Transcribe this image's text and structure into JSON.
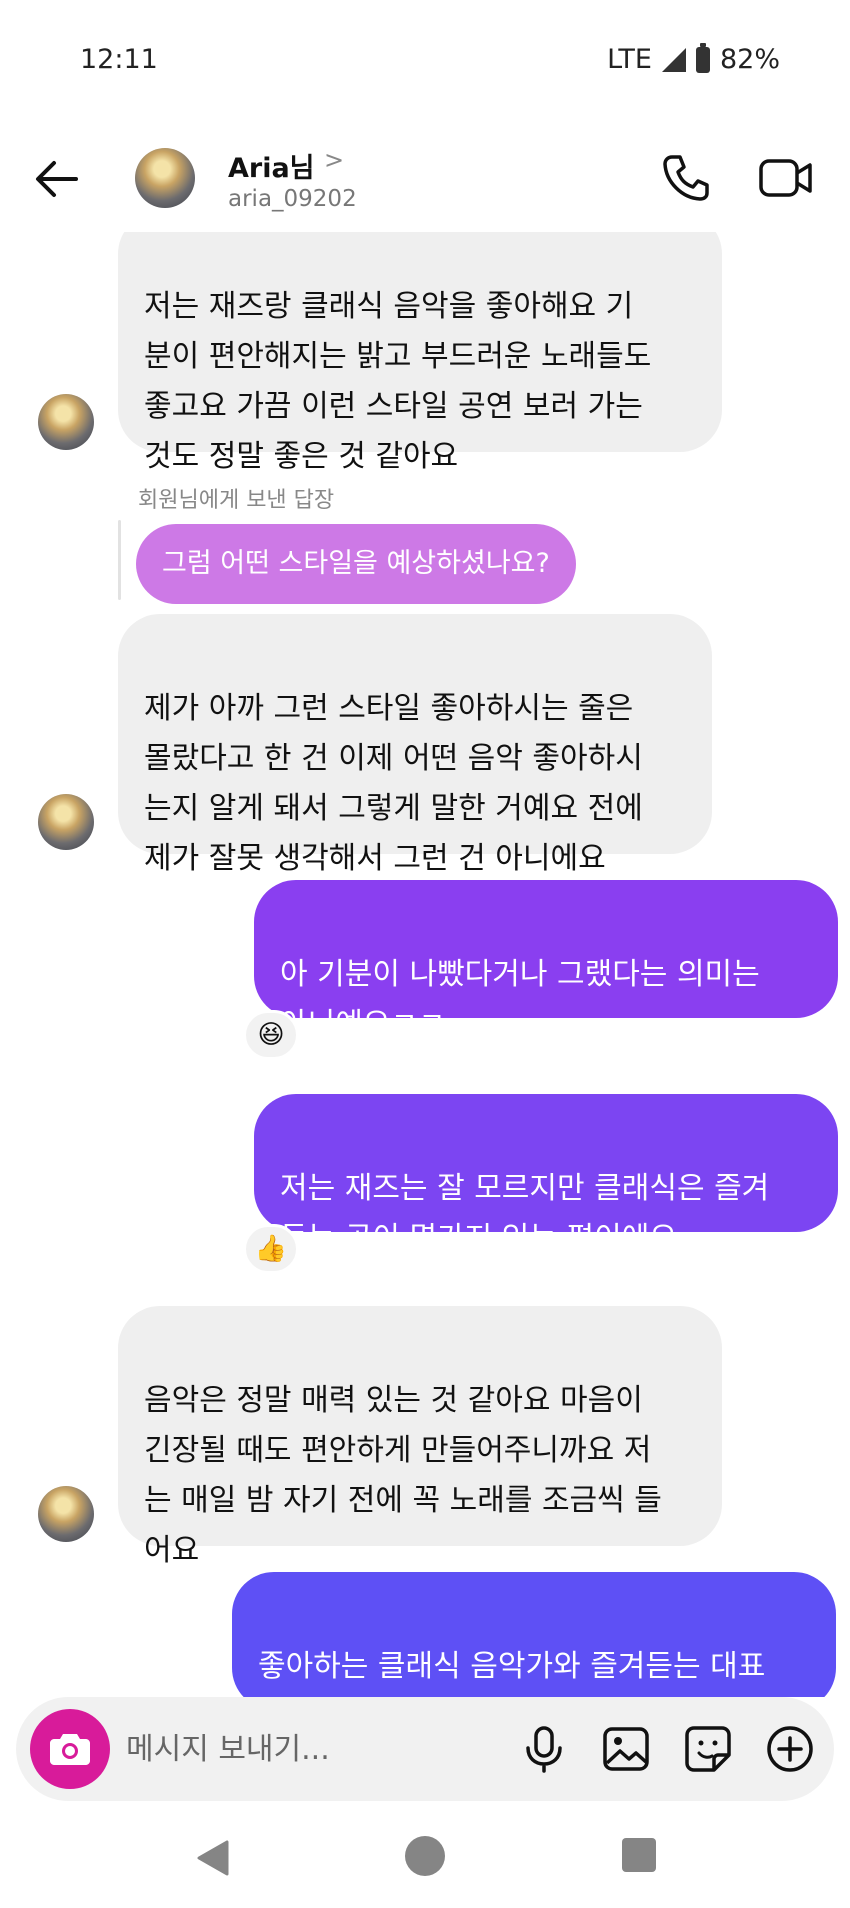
{
  "status_bar": {
    "time": "12:11",
    "network": "LTE",
    "battery": "82%"
  },
  "header": {
    "name": "Aria님",
    "chevron": ">",
    "username": "aria_09202"
  },
  "messages": [
    {
      "text": "저는 재즈랑 클래식 음악을 좋아해요 기\n분이 편안해지는 밝고 부드러운 노래들도\n좋고요 가끔 이런 스타일 공연 보러 가는\n것도 정말 좋은 것 같아요"
    },
    {
      "reply_label": "회원님에게 보낸 답장",
      "reply_text": "그럼 어떤 스타일을 예상하셨나요?"
    },
    {
      "text": "제가 아까 그런 스타일 좋아하시는 줄은\n몰랐다고 한 건 이제 어떤 음악 좋아하시\n는지 알게 돼서 그렇게 말한 거예요 전에\n제가 잘못 생각해서 그런 건 아니에요"
    },
    {
      "text": "아 기분이 나빴다거나 그랬다는 의미는\n아니예요ㅋㅋ",
      "reaction": "😆"
    },
    {
      "text": "저는 재즈는 잘 모르지만 클래식은 즐겨\n듣는 곡이 몇가지 있는 편이에요",
      "reaction": "👍"
    },
    {
      "text": "음악은 정말 매력 있는 것 같아요 마음이\n긴장될 때도 편안하게 만들어주니까요 저\n는 매일 밤 자기 전에 꼭 노래를 조금씩 들\n어요"
    },
    {
      "text": "좋아하는 클래식 음악가와 즐겨듣는 대표\n적인 곡이 궁금해요ㅎㅎ"
    }
  ],
  "composer": {
    "placeholder": "메시지 보내기..."
  },
  "icons": {
    "back": "arrow-left-icon",
    "call": "phone-icon",
    "video": "video-camera-icon",
    "camera": "camera-icon",
    "mic": "microphone-icon",
    "gallery": "image-icon",
    "sticker": "sticker-icon",
    "more": "plus-circle-icon"
  },
  "colors": {
    "incoming_bubble": "#efefef",
    "outgoing_gradient_top": "#8a3ff0",
    "outgoing_gradient_bottom": "#5a52f5",
    "reply_bubble": "#cd79e6",
    "camera_button": "#d81b9a"
  }
}
